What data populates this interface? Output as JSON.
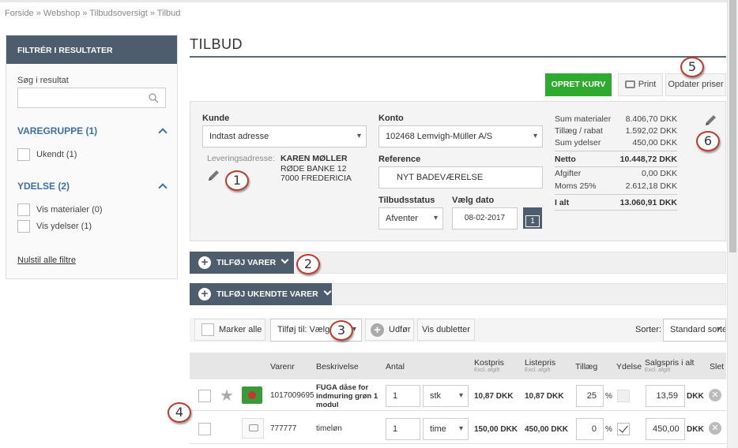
{
  "breadcrumb": "Forside » Webshop » Tilbudsoversigt » Tilbud",
  "sidebar": {
    "header": "FILTRÉR I RESULTATER",
    "search_label": "Søg i resultat",
    "group1_title": "VAREGRUPPE (1)",
    "group1_items": [
      "Ukendt (1)"
    ],
    "group2_title": "YDELSE (2)",
    "group2_items": [
      "Vis materialer (0)",
      "Vis ydelser (1)"
    ],
    "reset_link": "Nulstil alle filtre"
  },
  "page_title": "TILBUD",
  "actions": {
    "create_cart": "OPRET KURV",
    "print": "Print",
    "update_prices": "Opdater priser"
  },
  "form": {
    "kunde_label": "Kunde",
    "kunde_value": "Indtast adresse",
    "delivery_label": "Leveringsadresse:",
    "delivery_name": "KAREN MØLLER",
    "delivery_street": "RØDE BANKE 12",
    "delivery_city": "7000 FREDERICIA",
    "konto_label": "Konto",
    "konto_value": "102468 Lemvigh-Müller A/S",
    "reference_label": "Reference",
    "reference_value": "NYT BADEVÆRELSE",
    "status_label": "Tilbudsstatus",
    "status_value": "Afventer",
    "date_label": "Vælg dato",
    "date_value": "08-02-2017",
    "calendar_day": "1"
  },
  "summary": [
    {
      "label": "Sum materialer",
      "value": "8.406,70 DKK",
      "bold": false
    },
    {
      "label": "Tillæg / rabat",
      "value": "1.592,02 DKK",
      "bold": false
    },
    {
      "label": "Sum ydelser",
      "value": "450,00 DKK",
      "bold": false
    },
    {
      "label": "Netto",
      "value": "10.448,72 DKK",
      "bold": true
    },
    {
      "label": "Afgifter",
      "value": "0,00 DKK",
      "bold": false
    },
    {
      "label": "Moms 25%",
      "value": "2.612,18 DKK",
      "bold": false
    },
    {
      "label": "I alt",
      "value": "13.060,91 DKK",
      "bold": true
    }
  ],
  "add_items_bar": "TILFØJ VARER",
  "add_unknown_bar": "TILFØJ UKENDTE VARER",
  "toolbar": {
    "select_all": "Marker alle",
    "add_to": "Tilføj til: Vælg",
    "execute": "Udfør",
    "duplicates": "Vis dubletter",
    "sort_label": "Sorter:",
    "sort_value": "Standard sorte"
  },
  "table": {
    "headers": {
      "varenr": "Varenr",
      "beskrivelse": "Beskrivelse",
      "antal": "Antal",
      "kostpris": "Kostpris",
      "kostpris_sub": "Excl. afgift",
      "listepris": "Listepris",
      "listepris_sub": "Excl. afgift",
      "tillaeg": "Tillæg",
      "ydelse": "Ydelse",
      "salgspris": "Salgspris i alt",
      "salgspris_sub": "Excl. afgift",
      "slet": "Slet"
    },
    "rows": [
      {
        "varenr": "1017009695",
        "description": "FUGA dåse for indmuring grøn 1 modul",
        "qty": "1",
        "unit": "stk",
        "cost": "10,87 DKK",
        "list": "10,87 DKK",
        "surcharge": "25",
        "pct": "%",
        "service": false,
        "total": "13,59",
        "currency": "DKK"
      },
      {
        "varenr": "777777",
        "description": "timeløn",
        "qty": "1",
        "unit": "time",
        "cost": "150,00 DKK",
        "list": "450,00 DKK",
        "surcharge": "0",
        "pct": "%",
        "service": true,
        "total": "450,00",
        "currency": "DKK"
      }
    ]
  },
  "callouts": [
    "1",
    "2",
    "3",
    "4",
    "5",
    "6"
  ]
}
